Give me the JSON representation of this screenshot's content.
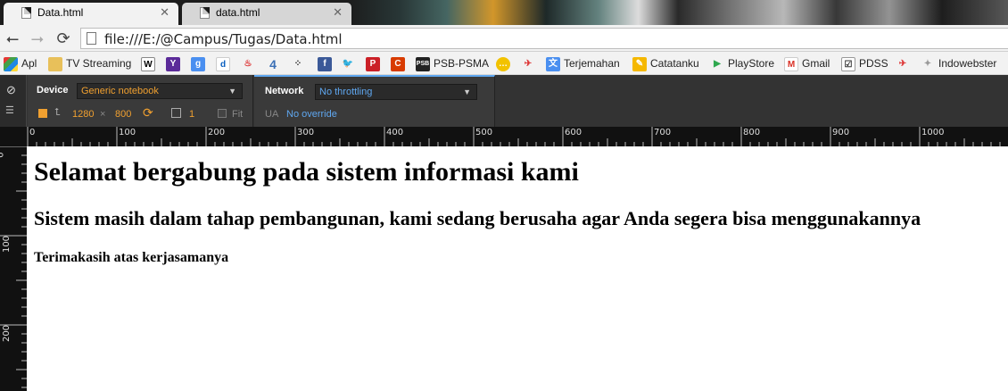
{
  "tabs": [
    {
      "title": "Data.html",
      "active": true
    },
    {
      "title": "data.html",
      "active": false
    }
  ],
  "toolbar": {
    "url": "file:///E:/@Campus/Tugas/Data.html"
  },
  "bookmarks": [
    {
      "label": "Apl",
      "icon": "apps-grid-icon"
    },
    {
      "label": "TV Streaming",
      "icon": "folder-icon"
    },
    {
      "label": "",
      "icon": "wikipedia-icon"
    },
    {
      "label": "",
      "icon": "yahoo-icon"
    },
    {
      "label": "",
      "icon": "google-icon"
    },
    {
      "label": "",
      "icon": "dailymotion-icon"
    },
    {
      "label": "",
      "icon": "thermometer-icon"
    },
    {
      "label": "",
      "icon": "four-icon"
    },
    {
      "label": "",
      "icon": "blackberry-icon"
    },
    {
      "label": "",
      "icon": "facebook-icon"
    },
    {
      "label": "",
      "icon": "twitter-icon"
    },
    {
      "label": "",
      "icon": "pinterest-icon"
    },
    {
      "label": "",
      "icon": "hotmail-icon"
    },
    {
      "label": "PSB-PSMA",
      "icon": "psb-icon"
    },
    {
      "label": "",
      "icon": "chat-icon"
    },
    {
      "label": "",
      "icon": "rocket-icon"
    },
    {
      "label": "Terjemahan",
      "icon": "translate-icon"
    },
    {
      "label": "Catatanku",
      "icon": "note-icon"
    },
    {
      "label": "PlayStore",
      "icon": "play-icon"
    },
    {
      "label": "Gmail",
      "icon": "gmail-icon"
    },
    {
      "label": "PDSS",
      "icon": "pdss-icon"
    },
    {
      "label": "",
      "icon": "rocket-icon"
    },
    {
      "label": "Indowebster",
      "icon": "indowebster-icon"
    }
  ],
  "devtools": {
    "device_label": "Device",
    "device_value": "Generic notebook",
    "width": "1280",
    "times": "×",
    "height": "800",
    "scale": "1",
    "fit_label": "Fit",
    "network_label": "Network",
    "network_value": "No throttling",
    "ua_label": "UA",
    "ua_value": "No override"
  },
  "ruler": {
    "top_labels": [
      "0",
      "100",
      "200",
      "300",
      "400",
      "500",
      "600",
      "700",
      "800",
      "900",
      "1000"
    ],
    "left_labels": [
      "0",
      "100",
      "200"
    ]
  },
  "page": {
    "h1": "Selamat bergabung pada sistem informasi kami",
    "h2": "Sistem masih dalam tahap pembangunan, kami sedang berusaha agar Anda segera bisa menggunakannya",
    "h4": "Terimakasih atas kerjasamanya"
  },
  "colors": {
    "devtools_bg": "#333333",
    "accent_orange": "#f0a030",
    "accent_blue": "#5fa7f0"
  }
}
